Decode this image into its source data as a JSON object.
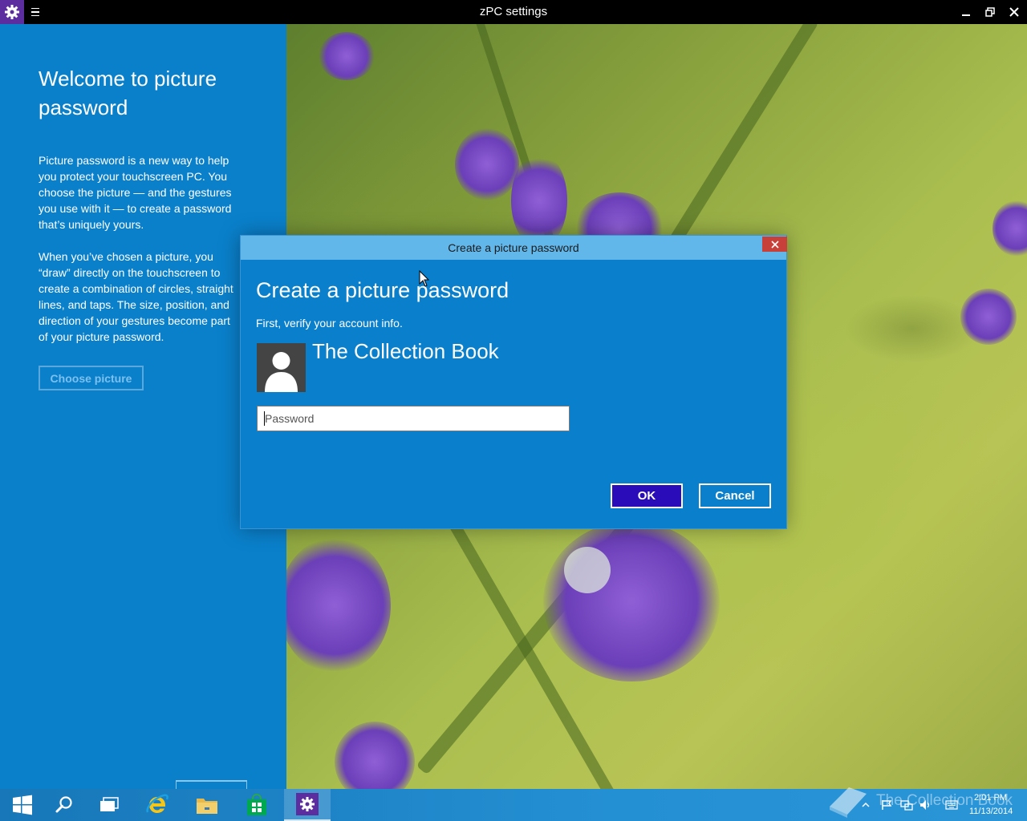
{
  "window": {
    "title": "zPC settings",
    "app_icon": "gear-icon",
    "controls": [
      "minimize-icon",
      "restore-icon",
      "close-icon"
    ]
  },
  "left_pane": {
    "heading": "Welcome to picture password",
    "paragraph_1": "Picture password is a new way to help you protect your touchscreen PC. You choose the picture — and the gestures you use with it — to create a password that’s uniquely yours.",
    "paragraph_2": "When you’ve chosen a picture, you “draw” directly on the touchscreen to create a combination of circles, straight lines, and taps. The size, position, and direction of your gestures become part of your picture password.",
    "choose_picture_label": "Choose picture"
  },
  "dialog": {
    "title": "Create a picture password",
    "heading": "Create a picture password",
    "subtitle": "First, verify your account info.",
    "account_name": "The Collection Book",
    "avatar_icon": "user-icon",
    "password_placeholder": "Password",
    "password_value": "",
    "ok_label": "OK",
    "cancel_label": "Cancel",
    "close_icon": "close-icon"
  },
  "taskbar": {
    "items": [
      {
        "icon": "windows-start-icon"
      },
      {
        "icon": "search-icon"
      },
      {
        "icon": "task-view-icon"
      },
      {
        "icon": "internet-explorer-icon"
      },
      {
        "icon": "file-explorer-icon"
      },
      {
        "icon": "store-icon"
      },
      {
        "icon": "settings-gear-icon",
        "active": true
      }
    ],
    "watermark": "The Collection Book",
    "tray_icons": [
      "chevron-up-icon",
      "flag-icon",
      "network-icon",
      "volume-icon",
      "keyboard-icon"
    ],
    "clock_time": "2:01 PM",
    "clock_date": "11/13/2014"
  },
  "colors": {
    "left_pane": "#0a80cb",
    "dialog_bg": "#0a7fcb",
    "dialog_titlebar": "#62b7ea",
    "ok_button": "#2a0cb8",
    "dialog_close": "#c7413a",
    "app_icon_bg": "#5b2d9e"
  }
}
